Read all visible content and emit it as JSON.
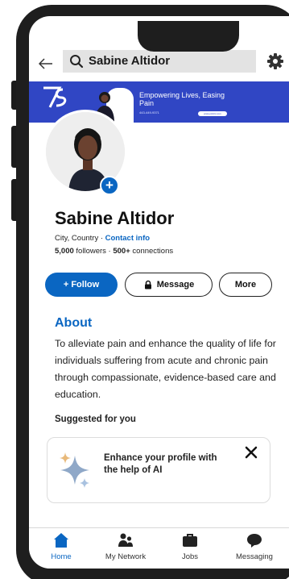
{
  "search": {
    "query": "Sabine Altidor"
  },
  "banner": {
    "title": "Empowering Lives, Easing Pain",
    "phone": "443-449-9371",
    "url": "www.pcldrc.com"
  },
  "profile": {
    "name": "Sabine Altidor",
    "location": "City, Country · ",
    "contact_label": "Contact info",
    "followers_count": "5,000",
    "followers_label": " followers · ",
    "connections_count": "500+",
    "connections_label": " connections"
  },
  "actions": {
    "follow": "+ Follow",
    "message": "Message",
    "more": "More"
  },
  "about": {
    "title": "About",
    "text": "To alleviate pain and enhance the quality of life for individuals suffering from acute and chronic pain through compassionate, evidence-based care and education."
  },
  "suggested": {
    "title": "Suggested for you",
    "card_text": "Enhance your profile with the help of AI"
  },
  "nav": {
    "items": [
      {
        "label": "Home",
        "icon": "home-icon",
        "active": true
      },
      {
        "label": "My Network",
        "icon": "people-icon",
        "active": false
      },
      {
        "label": "Jobs",
        "icon": "briefcase-icon",
        "active": false
      },
      {
        "label": "Messaging",
        "icon": "chat-icon",
        "active": false
      }
    ]
  },
  "colors": {
    "accent": "#0a66c2",
    "banner": "#3046c4",
    "phone_frame": "#1e1e1e"
  }
}
